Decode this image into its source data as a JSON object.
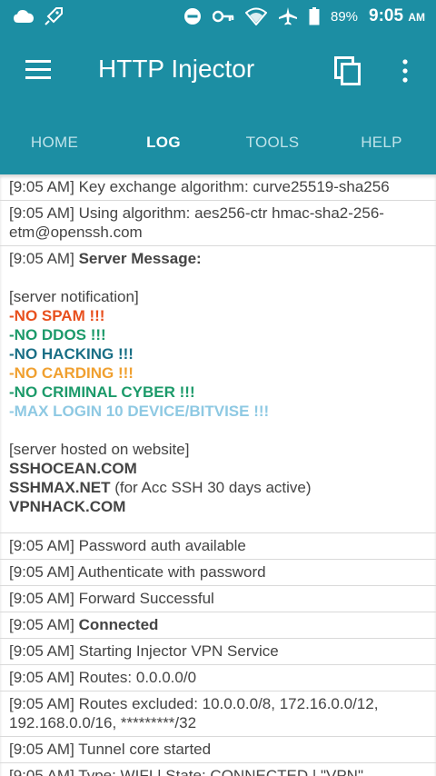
{
  "status_bar": {
    "battery": "89%",
    "time": "9:05",
    "ampm": "AM"
  },
  "app_bar": {
    "title": "HTTP Injector"
  },
  "tabs": [
    "HOME",
    "LOG",
    "TOOLS",
    "HELP"
  ],
  "log": {
    "rows": [
      {
        "ts": "[9:05 AM]",
        "text": "Key exchange algorithm: curve25519-sha256"
      },
      {
        "ts": "[9:05 AM]",
        "text": "Using algorithm: aes256-ctr hmac-sha2-256-etm@openssh.com"
      }
    ],
    "server_message": {
      "ts": "[9:05 AM]",
      "label": "Server Message:",
      "notification": "[server notification]",
      "rules": [
        {
          "text": "-NO SPAM !!!",
          "color": "#e8501e"
        },
        {
          "text": "-NO DDOS !!!",
          "color": "#1c9a6a"
        },
        {
          "text": "-NO HACKING !!!",
          "color": "#1a6f86"
        },
        {
          "text": "-NO CARDING !!!",
          "color": "#f0a030"
        },
        {
          "text": "-NO CRIMINAL CYBER !!!",
          "color": "#1c9a6a"
        },
        {
          "text": "-MAX LOGIN 10 DEVICE/BITVISE !!!",
          "color": "#8ec9e3"
        }
      ],
      "hosted": "[server hosted on website]",
      "sites": [
        {
          "name": "SSHOCEAN.COM",
          "note": ""
        },
        {
          "name": "SSHMAX.NET",
          "note": " (for Acc SSH 30 days active)"
        },
        {
          "name": "VPNHACK.COM",
          "note": ""
        }
      ]
    },
    "rows2": [
      {
        "ts": "[9:05 AM]",
        "text": "Password auth available",
        "bold": false
      },
      {
        "ts": "[9:05 AM]",
        "text": "Authenticate with password",
        "bold": false
      },
      {
        "ts": "[9:05 AM]",
        "text": "Forward Successful",
        "bold": false
      },
      {
        "ts": "[9:05 AM]",
        "text": "Connected",
        "bold": true
      },
      {
        "ts": "[9:05 AM]",
        "text": "Starting Injector VPN Service",
        "bold": false
      },
      {
        "ts": "[9:05 AM]",
        "text": "Routes: 0.0.0.0/0",
        "bold": false
      },
      {
        "ts": "[9:05 AM]",
        "text": "Routes excluded: 10.0.0.0/8, 172.16.0.0/12, 192.168.0.0/16, *********/32",
        "bold": false
      },
      {
        "ts": "[9:05 AM]",
        "text": "Tunnel core started",
        "bold": false
      },
      {
        "ts": "[9:05 AM]",
        "text": "Type: WIFI | State: CONNECTED | \"VPN\"",
        "bold": false
      }
    ]
  }
}
